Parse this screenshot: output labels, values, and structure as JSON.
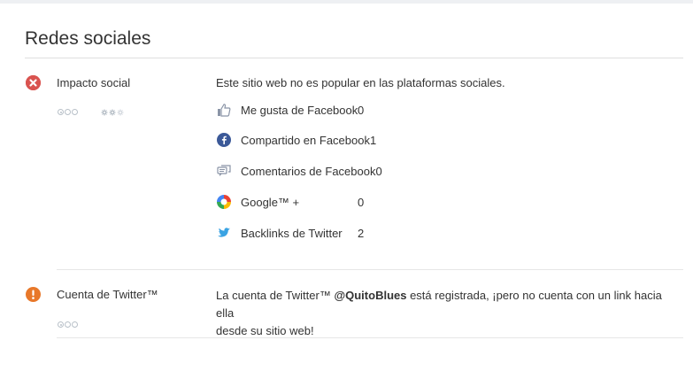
{
  "section": {
    "title": "Redes sociales"
  },
  "social_impact": {
    "label": "Impacto social",
    "status": "error",
    "description": "Este sitio web no es popular en las plataformas sociales.",
    "metrics": [
      {
        "icon": "thumbs-up-icon",
        "label": "Me gusta de Facebook",
        "value": "0"
      },
      {
        "icon": "facebook-icon",
        "label": "Compartido en Facebook",
        "value": "1"
      },
      {
        "icon": "comments-icon",
        "label": "Comentarios de Facebook",
        "value": "0"
      },
      {
        "icon": "google-icon",
        "label": "Google™ +",
        "value": "0"
      },
      {
        "icon": "twitter-icon",
        "label": "Backlinks de Twitter",
        "value": "2"
      }
    ]
  },
  "twitter_account": {
    "label": "Cuenta de Twitter™",
    "status": "warning",
    "description_prefix": "La cuenta de Twitter™ ",
    "handle": "@QuitoBlues",
    "description_line1_suffix": " está registrada, ¡pero no cuenta con un link hacia ella",
    "description_line2": "desde su sitio web!"
  },
  "colors": {
    "error": "#d9534f",
    "warning": "#e8782a",
    "twitter": "#3aa3e3",
    "facebook": "#3b5998",
    "icon_grey": "#8a94a6"
  }
}
